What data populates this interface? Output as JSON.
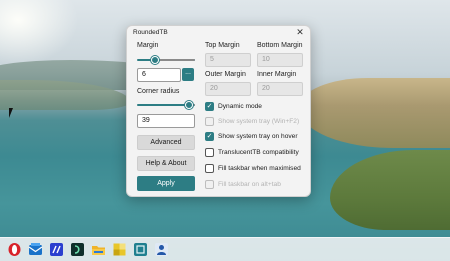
{
  "window": {
    "title": "RoundedTB",
    "close_glyph": "✕"
  },
  "left": {
    "margin_label": "Margin",
    "margin_value": "6",
    "margin_slider_level": 0.3,
    "more_button": "...",
    "corner_radius_label": "Corner radius",
    "corner_radius_value": "39",
    "corner_slider_level": 0.85,
    "advanced_button": "Advanced",
    "help_button": "Help & About",
    "apply_button": "Apply"
  },
  "right": {
    "top_margin_label": "Top Margin",
    "top_margin_value": "5",
    "bottom_margin_label": "Bottom Margin",
    "bottom_margin_value": "10",
    "outer_margin_label": "Outer Margin",
    "outer_margin_value": "20",
    "inner_margin_label": "Inner Margin",
    "inner_margin_value": "20"
  },
  "options": [
    {
      "label": "Dynamic mode",
      "checked": true,
      "disabled": false
    },
    {
      "label": "Show system tray (Win+F2)",
      "checked": false,
      "disabled": true
    },
    {
      "label": "Show system tray on hover",
      "checked": true,
      "disabled": false
    },
    {
      "label": "TranslucentTB compatibility",
      "checked": false,
      "disabled": false
    },
    {
      "label": "Fill taskbar when maximised",
      "checked": false,
      "disabled": false
    },
    {
      "label": "Fill taskbar on alt+tab",
      "checked": false,
      "disabled": true
    }
  ],
  "taskbar": {
    "icons": [
      "opera-icon",
      "mail-icon",
      "app-blue-icon",
      "terminal-icon",
      "file-explorer-icon",
      "puzzle-icon",
      "app-teal-icon",
      "user-app-icon"
    ],
    "colors": {
      "opera": "#d8232a",
      "mail": "#1a73c9",
      "blue_app": "#2b3fcf",
      "terminal": "#0f2f2b",
      "folder": "#f0b429",
      "puzzle": "#e8c62a",
      "teal": "#1f7f8f",
      "user": "#2458a8"
    }
  },
  "accent": "#2d7d84"
}
